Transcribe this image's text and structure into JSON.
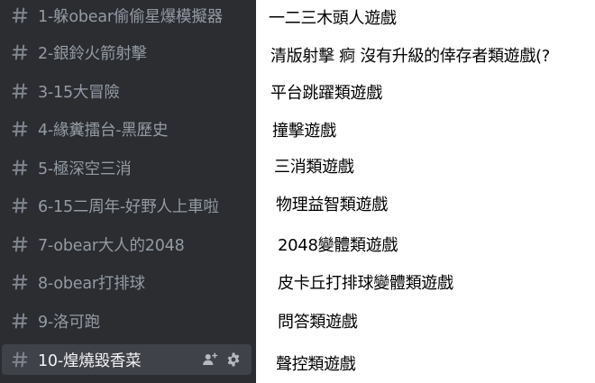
{
  "channels": [
    {
      "name": "1-躲obear偷偷星爆模擬器"
    },
    {
      "name": "2-銀鈴火箭射擊"
    },
    {
      "name": "3-15大冒險"
    },
    {
      "name": "4-緣糞擂台-黑歷史"
    },
    {
      "name": "5-極深空三消"
    },
    {
      "name": "6-15二周年-好野人上車啦"
    },
    {
      "name": "7-obear大人的2048"
    },
    {
      "name": "8-obear打排球"
    },
    {
      "name": "9-洛可跑"
    },
    {
      "name": "10-煌燒毀香菜",
      "selected": true
    }
  ],
  "descriptions": [
    "一二三木頭人遊戲",
    "清版射擊 痾 沒有升級的倖存者類遊戲(?",
    "平台跳躍類遊戲",
    "撞擊遊戲",
    "三消類遊戲",
    "物理益智類遊戲",
    "2048變體類遊戲",
    "皮卡丘打排球變體類遊戲",
    "問答類遊戲",
    "聲控類遊戲"
  ],
  "icons": {
    "channel": "hash-icon",
    "invite": "add-member-icon",
    "settings": "gear-icon"
  },
  "colors": {
    "sidebar_bg": "#2b2d31",
    "selected_bg": "#404249",
    "muted_text": "#949ba4",
    "selected_text": "#f2f3f5"
  }
}
